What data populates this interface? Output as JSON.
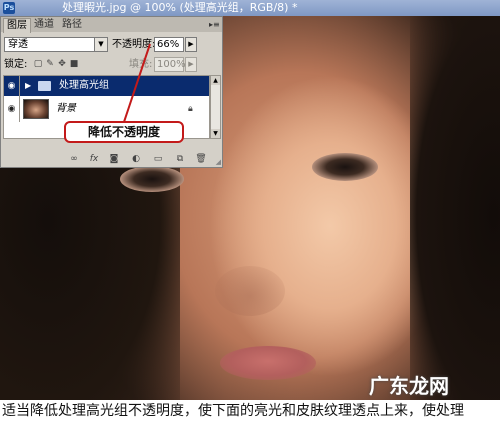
{
  "window": {
    "title": "处理暇光.jpg @ 100% (处理高光组，RGB/8) *"
  },
  "layers_panel": {
    "tabs": [
      {
        "label": "图层",
        "active": true
      },
      {
        "label": "通道",
        "active": false
      },
      {
        "label": "路径",
        "active": false
      }
    ],
    "blend_mode": "穿透",
    "opacity_label": "不透明度:",
    "opacity_value": "66%",
    "lock_label": "锁定:",
    "fill_label": "填充:",
    "fill_value": "100%",
    "layers": [
      {
        "name": "处理高光组",
        "type": "group",
        "selected": true,
        "visible": true
      },
      {
        "name": "背景",
        "type": "background",
        "selected": false,
        "visible": true,
        "locked": true
      }
    ],
    "bottom_tools": [
      "link-icon",
      "fx-icon",
      "mask-icon",
      "adjustment-icon",
      "folder-icon",
      "new-layer-icon",
      "trash-icon"
    ]
  },
  "annotation": {
    "text": "降低不透明度"
  },
  "watermark": "广东龙网",
  "caption": "适当降低处理高光组不透明度，使下面的亮光和皮肤纹理透点上来，使处理",
  "colors": {
    "selected_row": "#0a2b6e",
    "callout_border": "#c31a1a",
    "panel_bg": "#d4d0c8"
  }
}
